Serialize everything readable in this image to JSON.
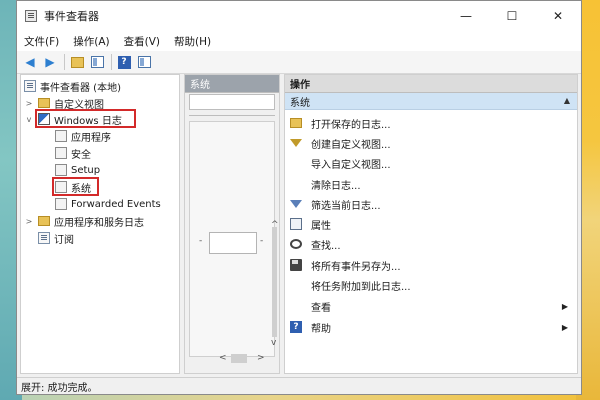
{
  "window": {
    "title": "事件查看器",
    "controls": {
      "minimize": "—",
      "maximize": "☐",
      "close": "✕"
    }
  },
  "menu": [
    "文件(F)",
    "操作(A)",
    "查看(V)",
    "帮助(H)"
  ],
  "tree": {
    "root": "事件查看器 (本地)",
    "items": [
      {
        "label": "自定义视图",
        "expanded": false
      },
      {
        "label": "Windows 日志",
        "expanded": true,
        "highlighted": true
      },
      {
        "label": "应用程序"
      },
      {
        "label": "安全"
      },
      {
        "label": "Setup"
      },
      {
        "label": "系统",
        "selected": true,
        "highlighted": true
      },
      {
        "label": "Forwarded Events"
      },
      {
        "label": "应用程序和服务日志",
        "expanded": false
      },
      {
        "label": "订阅"
      }
    ]
  },
  "middle": {
    "header": "系统",
    "marks": {
      "left": "-",
      "right": "-",
      "up": "^",
      "down": "v",
      "hleft": "<",
      "hright": ">"
    }
  },
  "actions": {
    "header": "操作",
    "section": "系统",
    "section_caret": "▲",
    "items": [
      {
        "label": "打开保存的日志...",
        "icon": "open-folder-icon"
      },
      {
        "label": "创建自定义视图...",
        "icon": "filter-icon"
      },
      {
        "label": "导入自定义视图...",
        "icon": "none"
      },
      {
        "label": "清除日志...",
        "icon": "none"
      },
      {
        "label": "筛选当前日志...",
        "icon": "filter-icon"
      },
      {
        "label": "属性",
        "icon": "properties-icon"
      },
      {
        "label": "查找...",
        "icon": "find-icon"
      },
      {
        "label": "将所有事件另存为...",
        "icon": "save-icon"
      },
      {
        "label": "将任务附加到此日志...",
        "icon": "none"
      },
      {
        "label": "查看",
        "icon": "none",
        "submenu": true,
        "arrow": "▶"
      },
      {
        "label": "帮助",
        "icon": "help-icon",
        "submenu": true,
        "arrow": "▶"
      }
    ]
  },
  "status": "展开: 成功完成。",
  "toolbar_icons": {
    "help": "?"
  },
  "colors": {
    "highlight": "#d32a2a",
    "section_bg": "#cfe3f5",
    "accent": "#2f5fb0"
  }
}
